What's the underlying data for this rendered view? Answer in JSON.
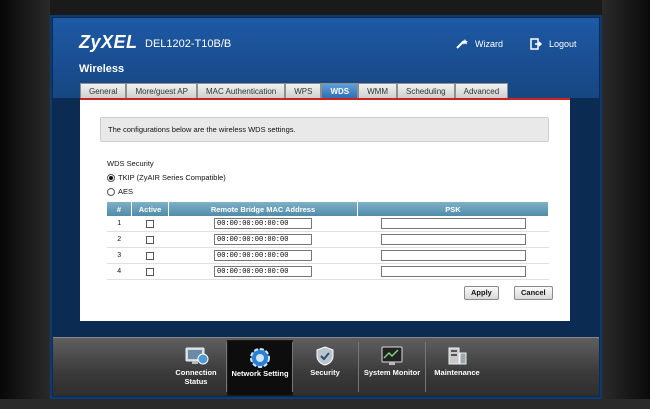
{
  "brand": {
    "logo": "ZyXEL",
    "model": "DEL1202-T10B/B"
  },
  "header": {
    "wizard_label": "Wizard",
    "logout_label": "Logout",
    "page_title": "Wireless"
  },
  "tabs": [
    {
      "label": "General",
      "active": false
    },
    {
      "label": "More/guest AP",
      "active": false
    },
    {
      "label": "MAC Authentication",
      "active": false
    },
    {
      "label": "WPS",
      "active": false
    },
    {
      "label": "WDS",
      "active": true
    },
    {
      "label": "WMM",
      "active": false
    },
    {
      "label": "Scheduling",
      "active": false
    },
    {
      "label": "Advanced",
      "active": false
    }
  ],
  "info_text": "The configurations below are the wireless WDS settings.",
  "wds_security": {
    "title": "WDS Security",
    "options": [
      {
        "label": "TKIP (ZyAIR Series Compatible)",
        "selected": true
      },
      {
        "label": "AES",
        "selected": false
      }
    ]
  },
  "table": {
    "headers": [
      "#",
      "Active",
      "Remote Bridge MAC Address",
      "PSK"
    ],
    "rows": [
      {
        "num": "1",
        "active": false,
        "mac": "00:00:00:00:00:00",
        "psk": ""
      },
      {
        "num": "2",
        "active": false,
        "mac": "00:00:00:00:00:00",
        "psk": ""
      },
      {
        "num": "3",
        "active": false,
        "mac": "00:00:00:00:00:00",
        "psk": ""
      },
      {
        "num": "4",
        "active": false,
        "mac": "00:00:00:00:00:00",
        "psk": ""
      }
    ]
  },
  "buttons": {
    "apply": "Apply",
    "cancel": "Cancel"
  },
  "dock": [
    {
      "label": "Connection Status",
      "icon": "connection-status-icon",
      "active": false
    },
    {
      "label": "Network Setting",
      "icon": "network-setting-icon",
      "active": true
    },
    {
      "label": "Security",
      "icon": "security-shield-icon",
      "active": false
    },
    {
      "label": "System Monitor",
      "icon": "system-monitor-icon",
      "active": false
    },
    {
      "label": "Maintenance",
      "icon": "maintenance-icon",
      "active": false
    }
  ],
  "colors": {
    "header_blue": "#1a4f93",
    "tab_active": "#2e6fb2",
    "accent_red": "#cc2222",
    "table_header": "#4f8ca8"
  }
}
